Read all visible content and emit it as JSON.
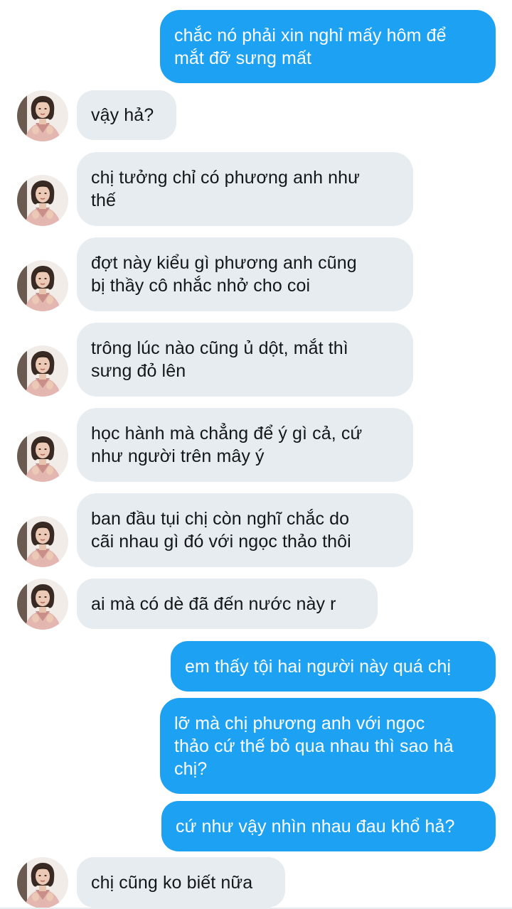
{
  "messages": [
    {
      "direction": "outgoing",
      "text": "chắc nó phải xin nghỉ mấy hôm để\nmắt đỡ sưng mất"
    },
    {
      "direction": "incoming",
      "text": "vậy hả?"
    },
    {
      "direction": "incoming",
      "text": "chị tưởng chỉ có phương anh như\nthế"
    },
    {
      "direction": "incoming",
      "text": "đợt này kiểu gì phương anh cũng\nbị thầy cô nhắc nhở cho coi"
    },
    {
      "direction": "incoming",
      "text": "trông lúc nào cũng ủ dột, mắt thì\nsưng đỏ lên"
    },
    {
      "direction": "incoming",
      "text": "học hành mà chẳng để ý gì cả, cứ\nnhư người trên mây ý"
    },
    {
      "direction": "incoming",
      "text": "ban đầu tụi chị còn nghĩ chắc do\ncãi nhau gì đó với ngọc thảo thôi"
    },
    {
      "direction": "incoming",
      "text": "ai mà có dè đã đến nước này r"
    },
    {
      "direction": "outgoing",
      "text": "em thấy tội hai người này quá chị"
    },
    {
      "direction": "outgoing",
      "text": "lỡ mà chị phương anh với ngọc\nthảo cứ thế bỏ qua nhau thì sao hả\nchị?"
    },
    {
      "direction": "outgoing",
      "text": "cứ như vậy nhìn nhau đau khổ hả?"
    },
    {
      "direction": "incoming",
      "text": "chị cũng ko biết nữa"
    }
  ],
  "colors": {
    "outgoing_bubble": "#1da1f2",
    "incoming_bubble": "#e6ecf0",
    "outgoing_text": "#ffffff",
    "incoming_text": "#14171a"
  }
}
